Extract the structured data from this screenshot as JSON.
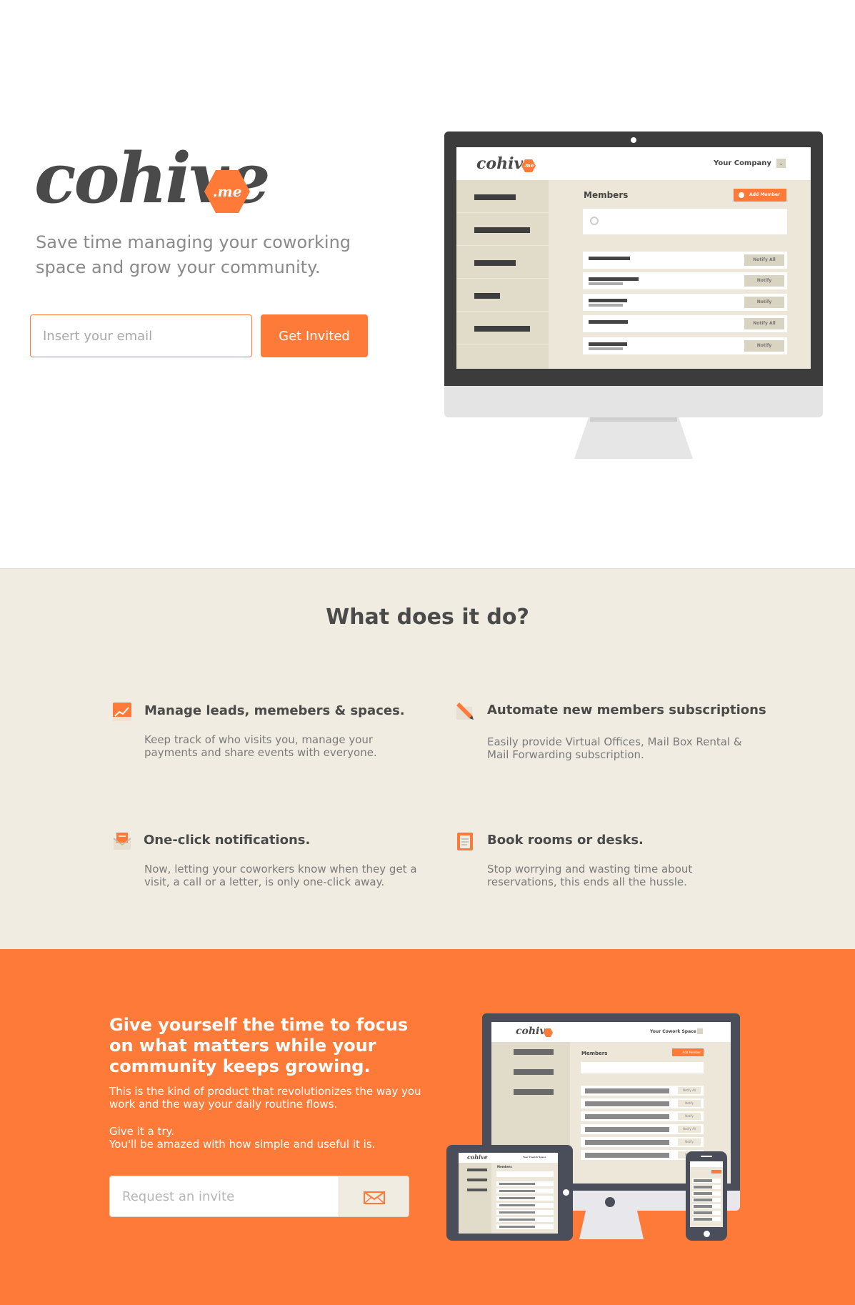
{
  "brand": {
    "logo_word": "cohive",
    "logo_suffix": ".me",
    "accent_color": "#fd7a39"
  },
  "hero": {
    "tagline": "Save time managing your coworking space and grow your community.",
    "email_placeholder": "Insert your email",
    "invite_button": "Get Invited",
    "screen": {
      "logo_word": "cohive",
      "logo_suffix": ".me",
      "company": "Your Company",
      "title": "Members",
      "add_button": "Add Member",
      "rows": [
        {
          "button": "Notify All"
        },
        {
          "button": "Notify"
        },
        {
          "button": "Notify"
        },
        {
          "button": "Notify All"
        },
        {
          "button": "Notify"
        }
      ]
    }
  },
  "features": {
    "title": "What does it do?",
    "items": [
      {
        "icon": "chart-icon",
        "title": "Manage leads, memebers & spaces.",
        "description": "Keep track of who visits you, manage your payments and share events with everyone."
      },
      {
        "icon": "pencil-icon",
        "title": "Automate new members subscriptions",
        "description": "Easily provide Virtual Offices, Mail Box Rental & Mail Forwarding subscription."
      },
      {
        "icon": "envelope-icon",
        "title": "One-click notifications.",
        "description": "Now, letting your coworkers know when they get a visit, a call or a letter, is only one-click away."
      },
      {
        "icon": "clipboard-icon",
        "title": "Book rooms or desks.",
        "description": "Stop worrying and wasting time about reservations, this ends all the hussle."
      }
    ]
  },
  "cta": {
    "headline": "Give yourself the time to focus on what matters while your community keeps growing.",
    "paragraph1": "This is the kind of product that revolutionizes the way you work and the way your daily routine flows.",
    "paragraph2_line1": "Give it a try.",
    "paragraph2_line2": "You'll be amazed with how simple and useful it is.",
    "input_placeholder": "Request an invite",
    "send_icon": "mail-icon",
    "devices": {
      "logo_word": "cohive",
      "company": "Your Cowork Space",
      "title": "Members",
      "add_button": "Add Member",
      "rows": [
        "Notify All",
        "Notify",
        "Notify",
        "Notify All",
        "Notify",
        "Notify"
      ]
    }
  }
}
